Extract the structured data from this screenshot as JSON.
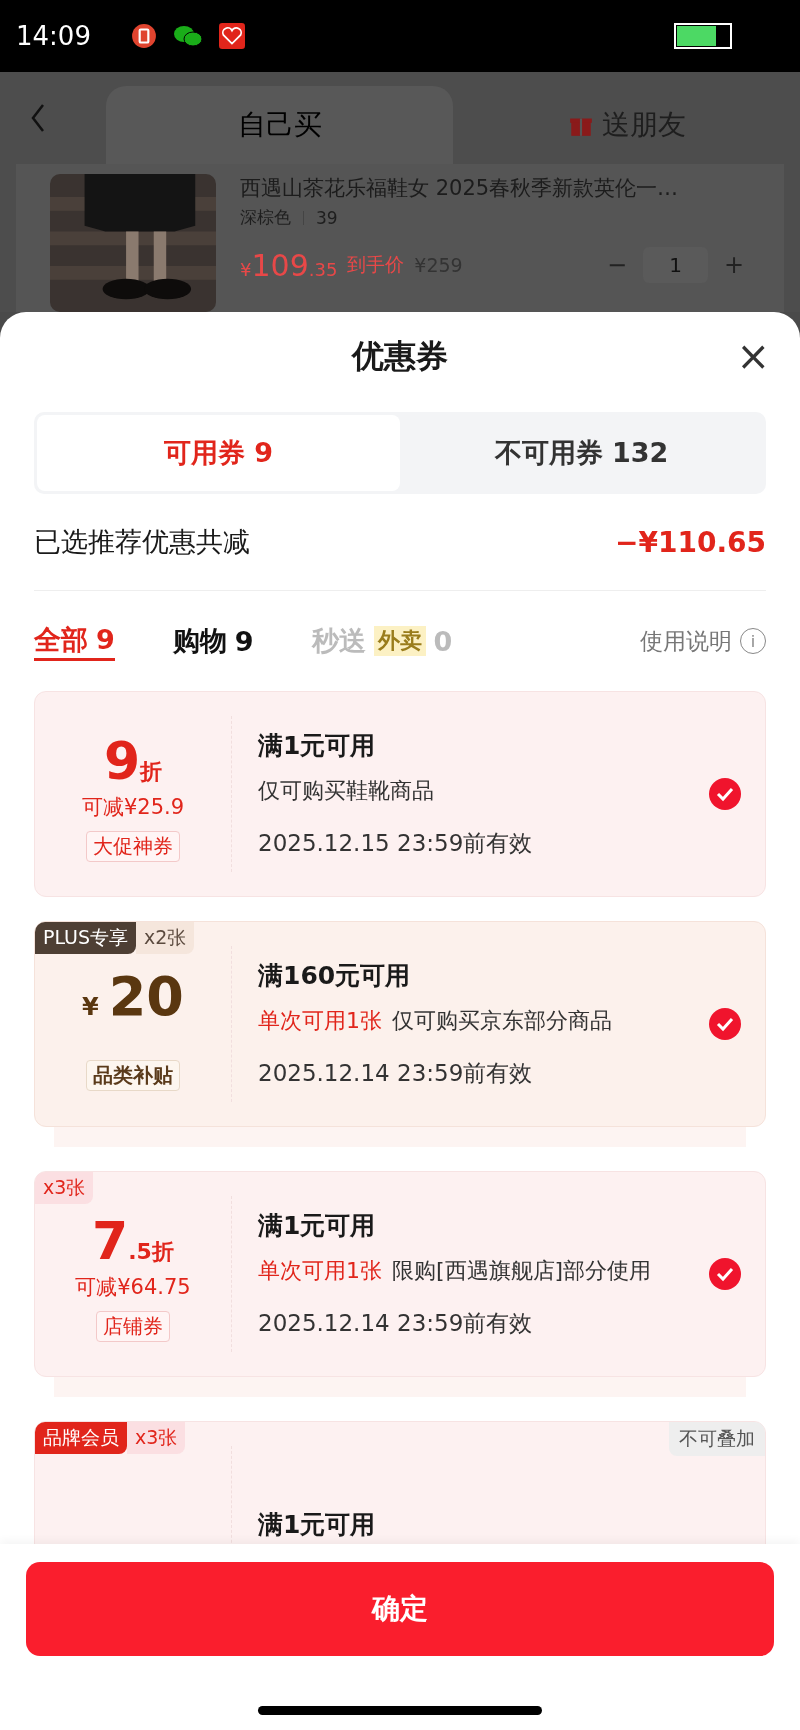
{
  "status_bar": {
    "time": "14:09"
  },
  "background": {
    "tabs": [
      {
        "label": "自己买",
        "selected": true
      },
      {
        "label": "送朋友",
        "selected": false
      }
    ],
    "product": {
      "kind": "picture",
      "title": "西遇山茶花乐福鞋女 2025春秋季新款英伦一…",
      "spec": "深棕色",
      "size": "39",
      "price_symbol": "¥",
      "price_int": "109",
      "price_dec": ".35",
      "price_note": "到手价",
      "original_price": "¥259",
      "quantity": "1",
      "minus": "−",
      "plus": "+"
    }
  },
  "sheet": {
    "title": "优惠券",
    "close": "×"
  },
  "tabs": [
    {
      "label": "可用券 9",
      "selected": true
    },
    {
      "label": "不可用券 132",
      "selected": false
    }
  ],
  "summary": {
    "label": "已选推荐优惠共减",
    "amount": "−¥110.65"
  },
  "filters": [
    {
      "label": "全部",
      "count": "9",
      "selected": true,
      "disabled": false
    },
    {
      "label": "购物",
      "count": "9",
      "selected": false,
      "disabled": false
    },
    {
      "label": "秒送",
      "tag": "外卖",
      "count": "0",
      "selected": false,
      "disabled": true
    }
  ],
  "help": {
    "label": "使用说明",
    "icon": "i"
  },
  "coupons": [
    {
      "kind": "discount",
      "value": "9",
      "unit": "折",
      "saving": "可减¥25.9",
      "tag": "大促神券",
      "condition": "满1元可用",
      "scope": "仅可购买鞋靴商品",
      "validity": "2025.12.15 23:59前有效",
      "checked": true
    },
    {
      "kind": "cash",
      "badge": {
        "label": "PLUS专享",
        "color": "#4e3f34"
      },
      "count": "x2张",
      "symbol": "¥",
      "value": "20",
      "tag": "品类补贴",
      "condition": "满160元可用",
      "limit": "单次可用1张",
      "scope": "仅可购买京东部分商品",
      "validity": "2025.12.14 23:59前有效",
      "checked": true
    },
    {
      "kind": "discount",
      "count": "x3张",
      "value": "7",
      "unit": ".5折",
      "saving": "可减¥64.75",
      "tag": "店铺券",
      "condition": "满1元可用",
      "limit": "单次可用1张",
      "scope": "限购[西遇旗舰店]部分使用",
      "validity": "2025.12.14 23:59前有效",
      "checked": true
    },
    {
      "kind": "partial",
      "badge": {
        "label": "品牌会员",
        "color": "#e1251b"
      },
      "count": "x3张",
      "note": "不可叠加",
      "condition": "满1元可用"
    }
  ],
  "confirm": {
    "label": "确定"
  }
}
